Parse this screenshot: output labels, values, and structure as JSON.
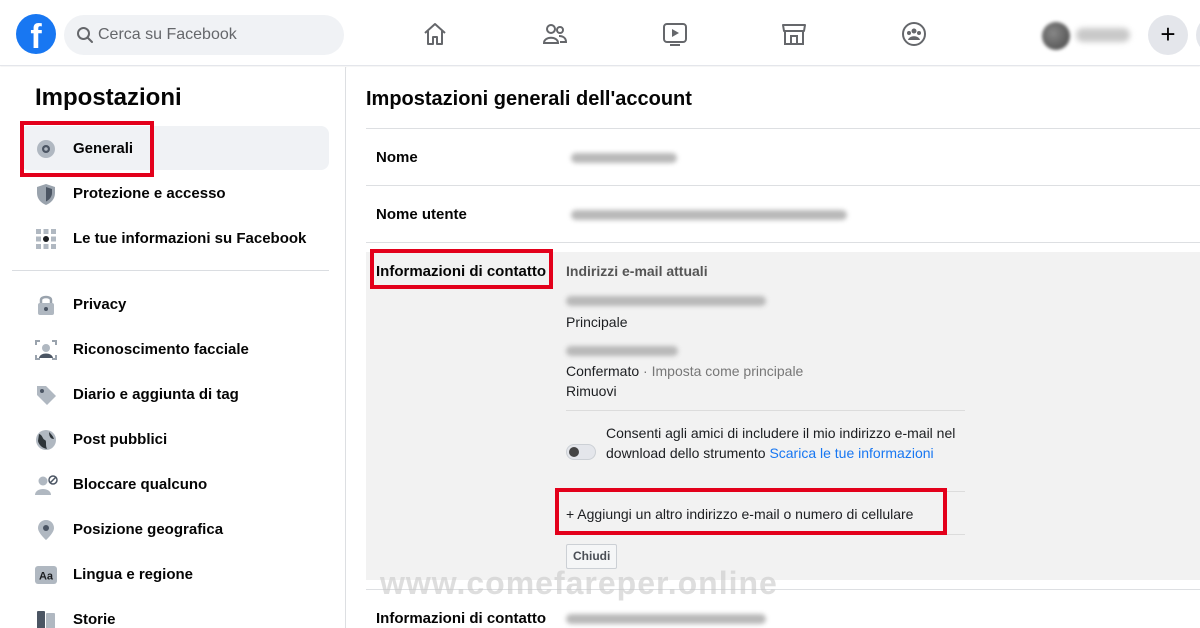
{
  "topbar": {
    "logo": "f",
    "search_placeholder": "Cerca su Facebook",
    "nav_icons": [
      "home-icon",
      "friends-icon",
      "watch-icon",
      "marketplace-icon",
      "groups-icon"
    ],
    "plus_label": "+"
  },
  "sidebar": {
    "title": "Impostazioni",
    "items": [
      {
        "label": "Generali",
        "icon": "gear-icon"
      },
      {
        "label": "Protezione e accesso",
        "icon": "shield-icon"
      },
      {
        "label": "Le tue informazioni su Facebook",
        "icon": "grid-icon"
      },
      {
        "label": "Privacy",
        "icon": "lock-icon"
      },
      {
        "label": "Riconoscimento facciale",
        "icon": "face-icon"
      },
      {
        "label": "Diario e aggiunta di tag",
        "icon": "tag-icon"
      },
      {
        "label": "Post pubblici",
        "icon": "globe-icon"
      },
      {
        "label": "Bloccare qualcuno",
        "icon": "block-user-icon"
      },
      {
        "label": "Posizione geografica",
        "icon": "location-icon"
      },
      {
        "label": "Lingua e regione",
        "icon": "language-icon"
      },
      {
        "label": "Storie",
        "icon": "book-icon"
      }
    ]
  },
  "main": {
    "title": "Impostazioni generali dell'account",
    "rows": {
      "name_label": "Nome",
      "username_label": "Nome utente",
      "contact_label": "Informazioni di contatto",
      "contact_label_bottom": "Informazioni di contatto"
    },
    "contact": {
      "heading": "Indirizzi e-mail attuali",
      "primary_status": "Principale",
      "confirmed_status": "Confermato",
      "separator": "·",
      "set_primary": "Imposta come principale",
      "remove": "Rimuovi",
      "consent_text": "Consenti agli amici di includere il mio indirizzo e-mail nel download dello strumento ",
      "consent_link": "Scarica le tue informazioni",
      "add_contact": "+ Aggiungi un altro indirizzo e-mail o numero di cellulare",
      "close_button": "Chiudi"
    }
  },
  "watermark": "www.comefareper.online",
  "colors": {
    "brand": "#1877f2",
    "highlight": "#e3001b",
    "active_bg": "#f0f2f5"
  }
}
